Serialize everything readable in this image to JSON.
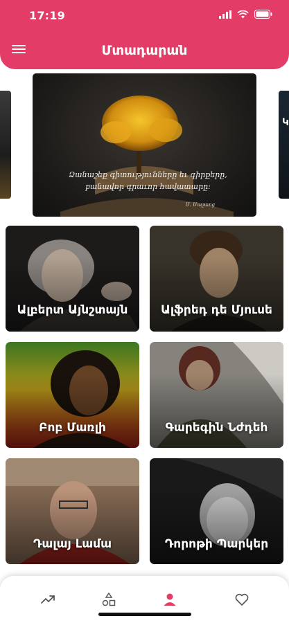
{
  "status_bar": {
    "time": "17:19"
  },
  "header": {
    "title": "Մտադարան"
  },
  "banner": {
    "quote": "Ձանաշեք գիտությունները եւ գիրքերը, բանավոր գրաւոր հավատարը:",
    "author": "Մ. Մաշտոց",
    "right_peek_letter": "Կ"
  },
  "cards": [
    {
      "label": "Ալբերտ Այնշտայն"
    },
    {
      "label": "Ալֆրեդ դե Մյուսե"
    },
    {
      "label": "Բոբ Մառլի"
    },
    {
      "label": "Գարեգին Նժդեհ"
    },
    {
      "label": "Դալայ Լամա"
    },
    {
      "label": "Դորոթի Պարկեր"
    }
  ],
  "nav": {
    "items": [
      "trending-icon",
      "categories-icon",
      "authors-icon",
      "favorites-icon"
    ],
    "active_index": 2,
    "active_color": "#e23c67"
  },
  "colors": {
    "accent": "#e23c67"
  }
}
